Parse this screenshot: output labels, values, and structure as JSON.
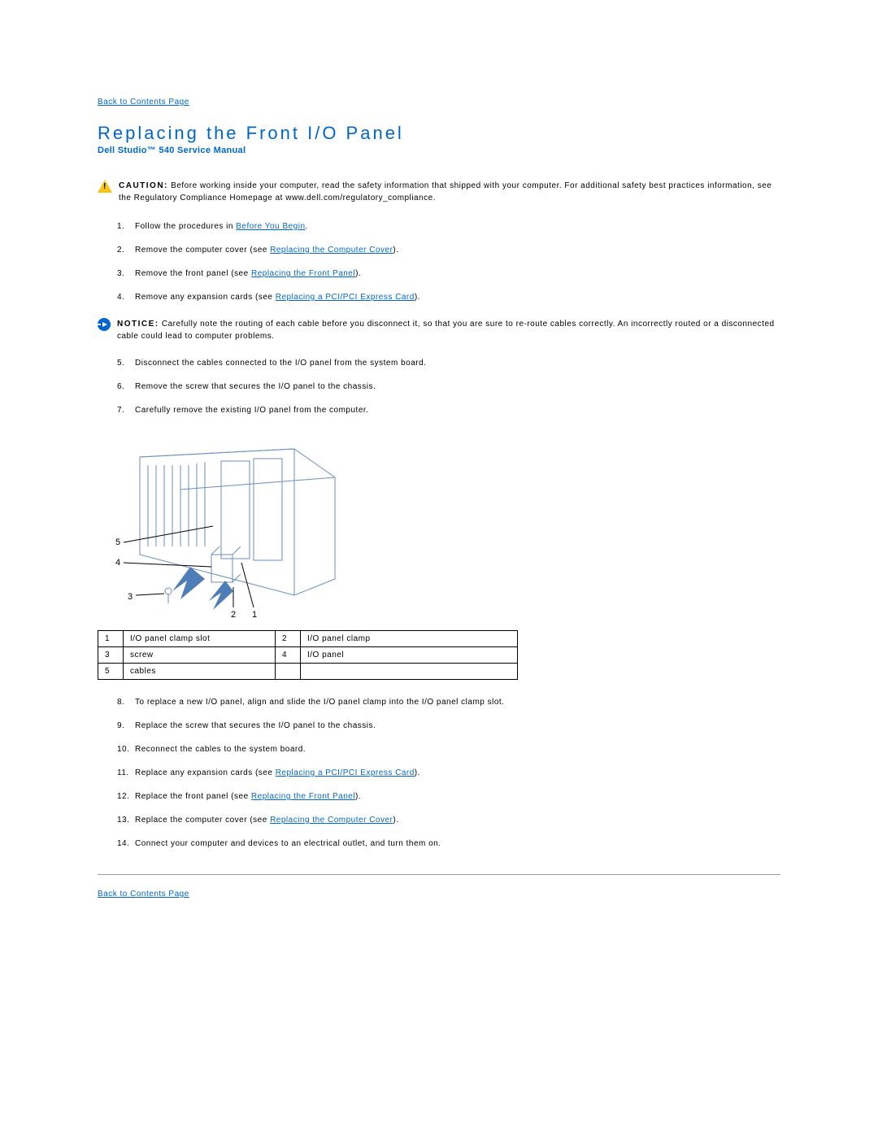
{
  "nav": {
    "back_top": "Back to Contents Page",
    "back_bottom": "Back to Contents Page"
  },
  "header": {
    "title": "Replacing the Front I/O Panel",
    "subtitle": "Dell Studio™ 540 Service Manual"
  },
  "caution": {
    "label": "CAUTION:",
    "text": " Before working inside your computer, read the safety information that shipped with your computer. For additional safety best practices information, see the Regulatory Compliance Homepage at www.dell.com/regulatory_compliance."
  },
  "notice": {
    "label": "NOTICE:",
    "text": " Carefully note the routing of each cable before you disconnect it, so that you are sure to re-route cables correctly. An incorrectly routed or a disconnected cable could lead to computer problems."
  },
  "steps_a": {
    "s1_pre": "Follow the procedures in ",
    "s1_link": "Before You Begin",
    "s1_post": ".",
    "s2_pre": "Remove the computer cover (see ",
    "s2_link": "Replacing the Computer Cover",
    "s2_post": ").",
    "s3_pre": "Remove the front panel (see ",
    "s3_link": "Replacing the Front Panel",
    "s3_post": ").",
    "s4_pre": "Remove any expansion cards (see ",
    "s4_link": "Replacing a PCI/PCI Express Card",
    "s4_post": ")."
  },
  "steps_b": {
    "s5": "Disconnect the cables connected to the I/O panel from the system board.",
    "s6": "Remove the screw that secures the I/O panel to the chassis.",
    "s7": "Carefully remove the existing I/O panel from the computer."
  },
  "parts": {
    "r1c1": "1",
    "r1c2": "I/O panel clamp slot",
    "r1c3": "2",
    "r1c4": "I/O panel clamp",
    "r2c1": "3",
    "r2c2": "screw",
    "r2c3": "4",
    "r2c4": "I/O panel",
    "r3c1": "5",
    "r3c2": "cables",
    "r3c3": "",
    "r3c4": ""
  },
  "steps_c": {
    "s8": "To replace a new I/O panel, align and slide the I/O panel clamp into the I/O panel clamp slot.",
    "s9": "Replace the screw that secures the I/O panel to the chassis.",
    "s10": "Reconnect the cables to the system board.",
    "s11_pre": "Replace any expansion cards (see ",
    "s11_link": "Replacing a PCI/PCI Express Card",
    "s11_post": ").",
    "s12_pre": "Replace the front panel (see ",
    "s12_link": "Replacing the Front Panel",
    "s12_post": ").",
    "s13_pre": "Replace the computer cover (see ",
    "s13_link": "Replacing the Computer Cover",
    "s13_post": ").",
    "s14": "Connect your computer and devices to an electrical outlet, and turn them on."
  },
  "diagram_labels": {
    "l1": "1",
    "l2": "2",
    "l3": "3",
    "l4": "4",
    "l5": "5"
  }
}
